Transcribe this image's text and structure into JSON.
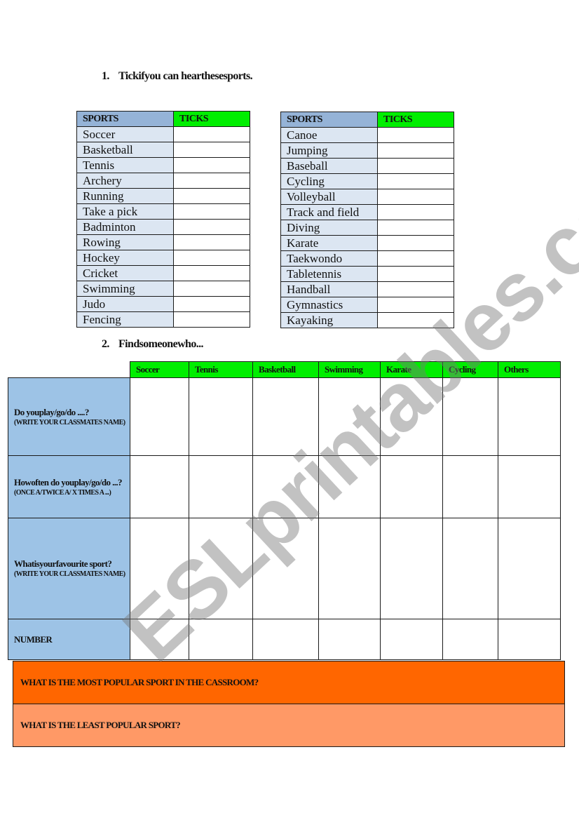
{
  "section1": {
    "number": "1.",
    "title": "Tickifyou can hearthesesports."
  },
  "table1": {
    "header_sports": "SPORTS",
    "header_ticks": "TICKS",
    "sports": [
      "Soccer",
      "Basketball",
      "Tennis",
      "Archery",
      "Running",
      "Take a pick",
      "Badminton",
      "Rowing",
      "Hockey",
      "Cricket",
      "Swimming",
      "Judo",
      "Fencing"
    ]
  },
  "table2": {
    "header_sports": "SPORTS",
    "header_ticks": "TICKS",
    "sports": [
      "Canoe",
      "Jumping",
      "Baseball",
      "Cycling",
      "Volleyball",
      "Track and field",
      "Diving",
      "Karate",
      "Taekwondo",
      "Tabletennis",
      "Handball",
      "Gymnastics",
      "Kayaking"
    ]
  },
  "section2": {
    "number": "2.",
    "title": "Findsomeonewho..."
  },
  "survey": {
    "columns": [
      "Soccer",
      "Tennis",
      "Basketball",
      "Swimming",
      "Karate",
      "Cycling",
      "Others"
    ],
    "rows": [
      {
        "question": "Do youplay/go/do ....?",
        "note": "(WRITE YOUR CLASSMATES NAME)"
      },
      {
        "question": "Howoften do youplay/go/do ...?",
        "note": "(ONCE A/TWICE A/ X TIMES A ...)"
      },
      {
        "question": "Whatisyourfavourite sport?",
        "note": "(WRITE YOUR CLASSMATES NAME)"
      },
      {
        "question": "NUMBER",
        "note": ""
      }
    ]
  },
  "questions": {
    "most_popular": "WHAT IS THE MOST POPULAR SPORT IN THE CASSROOM?",
    "least_popular": "WHAT IS THE LEAST POPULAR SPORT?"
  },
  "watermark": "ESLprintables.com",
  "colors": {
    "header_green": "#00ee00",
    "sport_blue_light": "#dce6f2",
    "header_blue": "#95b3d7",
    "row_header_blue": "#9dc3e6",
    "orange_dark": "#ff6600",
    "orange_light": "#ff9966"
  }
}
